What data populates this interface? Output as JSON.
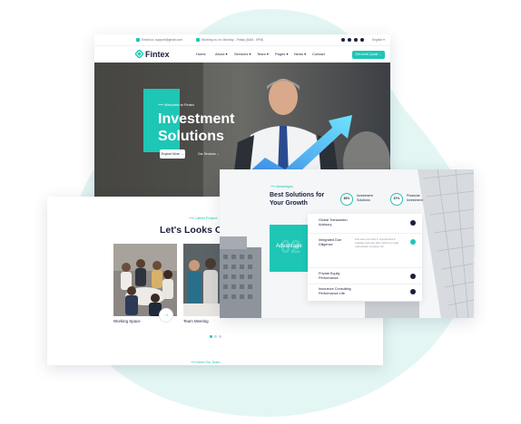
{
  "topbar": {
    "email": "Email us: support@gmail.com",
    "hours": "Working us on: Monday - Friday (8AM - 5PM)",
    "language": "English"
  },
  "nav": {
    "brand": "Fintex",
    "items": [
      "Home",
      "About",
      "Services",
      "Team",
      "Pages",
      "News",
      "Contact"
    ],
    "cta": "Get a free Quote"
  },
  "hero": {
    "eyebrow": "Welcome to Fintex",
    "title_line1": "Investment",
    "title_line2": "Solutions",
    "explore_label": "Explore More",
    "services_label": "Our Services"
  },
  "projects": {
    "eyebrow": "Latest Project",
    "title": "Let's Looks Our C",
    "items": [
      "Working Space",
      "Team Meeting"
    ],
    "next_arrow": "→",
    "team_link": "Meet Our Team"
  },
  "advantage": {
    "eyebrow": "Advantages",
    "title_line1": "Best Solutions for",
    "title_line2": "Your Growth",
    "stats": [
      {
        "value": "85%",
        "label_line1": "Investment",
        "label_line2": "Solutions"
      },
      {
        "value": "67%",
        "label_line1": "Financial",
        "label_line2": "Investment"
      }
    ],
    "box_label": "Advantage",
    "box_number": "02",
    "accordion": [
      {
        "line1": "Global Transaction",
        "line2": "Advisory"
      },
      {
        "line1": "Integrated Due",
        "line2": "Diligence"
      },
      {
        "line1": "Private Equity",
        "line2": "Performance"
      },
      {
        "line1": "Insurance Consulting",
        "line2": "Performance Life"
      }
    ],
    "accordion_body": "Duis aute irure dolor in reprehenderit in voluptate velit esse cillum dolore eu fugiat nulla pariatur excepteur sint"
  },
  "colors": {
    "accent": "#1ec6b6",
    "navy": "#1b1f3b",
    "blob": "#e3f6f4"
  }
}
